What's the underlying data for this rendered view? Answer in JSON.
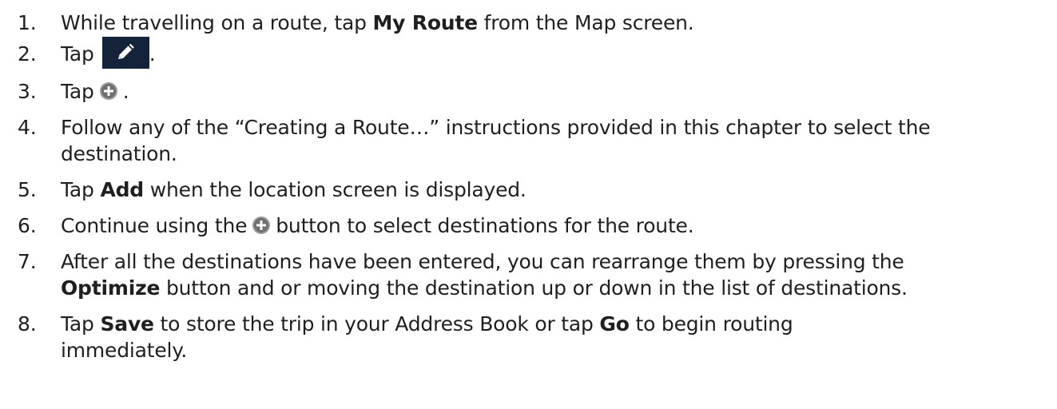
{
  "steps": [
    {
      "num": "1.",
      "before": "While travelling on a route, tap ",
      "bold": "My Route",
      "after": " from the Map screen."
    },
    {
      "num": "2.",
      "before": "Tap",
      "icon": "pencil-edit-icon",
      "after": "."
    },
    {
      "num": "3.",
      "before": "Tap",
      "icon": "plus-circle-icon",
      "after": "."
    },
    {
      "num": "4.",
      "line1": "Follow any of the “Creating a Route…” instructions provided in this chapter to select the",
      "line2": "destination."
    },
    {
      "num": "5.",
      "before": "Tap ",
      "bold": "Add",
      "after": " when the location screen is displayed."
    },
    {
      "num": "6.",
      "before": "Continue using the",
      "icon": "plus-circle-icon",
      "after": "button to select destinations for the route."
    },
    {
      "num": "7.",
      "line1": "After all the destinations have been entered, you can rearrange them by pressing the",
      "bold": "Optimize",
      "after": " button and or moving the destination up or down in the list of destinations."
    },
    {
      "num": "8.",
      "before": "Tap ",
      "bold": "Save",
      "middle": " to store the trip in your Address Book or tap ",
      "bold2": "Go",
      "after": " to begin routing",
      "line2": "immediately."
    }
  ],
  "colors": {
    "text": "#1f1f1f",
    "edit_button_bg": "#15233a",
    "plus_circle": "#9a9a9a"
  }
}
